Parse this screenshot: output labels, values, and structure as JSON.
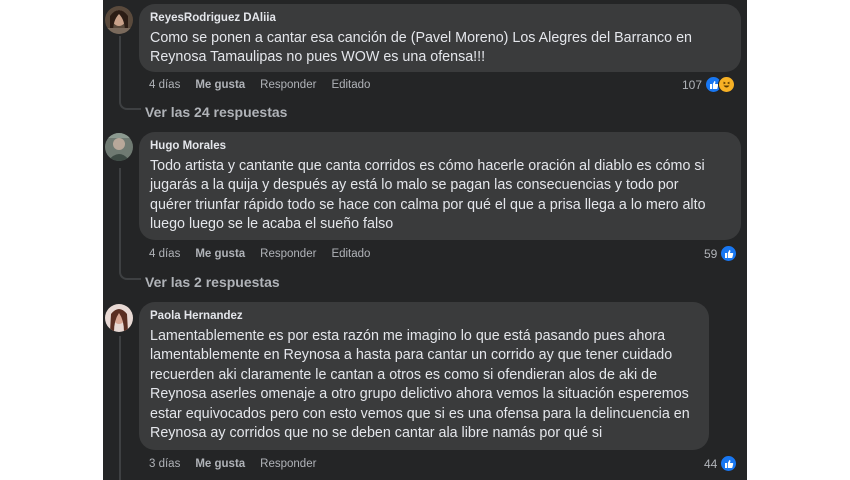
{
  "comments": [
    {
      "author": "ReyesRodriguez DAliia",
      "text": "Como se ponen a cantar esa canción de (Pavel Moreno) Los Alegres del Barranco en\nReynosa Tamaulipas no pues WOW es una ofensa!!!",
      "time": "4 días",
      "like_label": "Me gusta",
      "reply_label": "Responder",
      "edited_label": "Editado",
      "reaction_count": "107",
      "reactions": [
        "like-icon",
        "haha-icon"
      ],
      "view_replies": "Ver las 24 respuestas"
    },
    {
      "author": "Hugo Morales",
      "text": "Todo artista y cantante que canta corridos es cómo hacerle oración al diablo es cómo si\njugarás a la quija y después ay está lo malo se pagan las consecuencias y todo por\nquérer triunfar rápido todo se hace con calma por qué el que a prisa llega a lo mero alto\nluego luego se le acaba el sueño falso",
      "time": "4 días",
      "like_label": "Me gusta",
      "reply_label": "Responder",
      "edited_label": "Editado",
      "reaction_count": "59",
      "reactions": [
        "like-icon"
      ],
      "view_replies": "Ver las 2 respuestas"
    },
    {
      "author": "Paola Hernandez",
      "text": "Lamentablemente es por esta razón me imagino lo que está pasando pues ahora\nlamentablemente en Reynosa a hasta para cantar un corrido ay que tener cuidado\nrecuerden aki claramente le cantan a otros es como si ofendieran alos de aki de\nReynosa aserles omenaje a otro grupo delictivo ahora vemos la situación esperemos\nestar equivocados pero con esto vemos que si es una ofensa para la delincuencia en\nReynosa ay corridos que no se deben cantar ala libre namás por qué si",
      "time": "3 días",
      "like_label": "Me gusta",
      "reply_label": "Responder",
      "reaction_count": "44",
      "reactions": [
        "like-icon"
      ]
    }
  ],
  "colors": {
    "background": "#242526",
    "bubble": "#3a3b3c",
    "text": "#e4e6eb",
    "secondary_text": "#b0b3b8",
    "like_blue": "#1877f2",
    "haha_yellow": "#f7b125"
  }
}
